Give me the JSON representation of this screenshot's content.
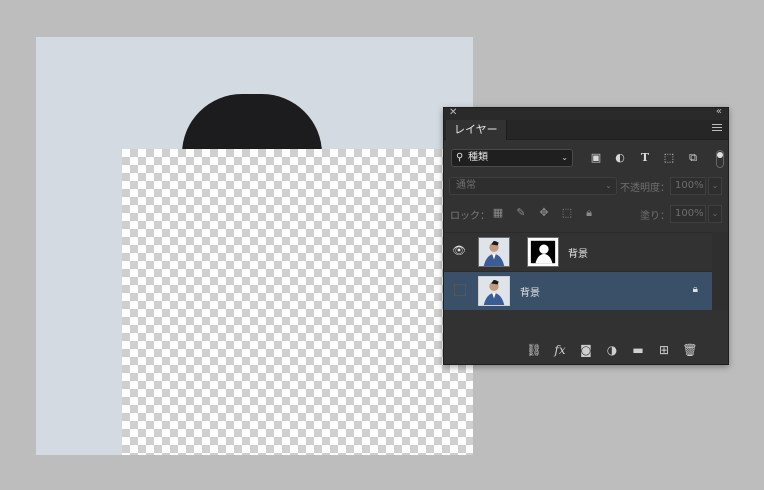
{
  "panel": {
    "tab_label": "レイヤー",
    "filter": {
      "selected": "種類"
    },
    "blend": {
      "mode": "通常",
      "opacity_label": "不透明度：",
      "opacity_value": "100%"
    },
    "lock": {
      "label": "ロック：",
      "fill_label": "塗り：",
      "fill_value": "100%"
    },
    "layers": [
      {
        "name": "背景",
        "visible": true,
        "has_mask": true,
        "selected": false,
        "locked": false
      },
      {
        "name": "背景",
        "visible": false,
        "has_mask": false,
        "selected": true,
        "locked": true
      }
    ],
    "icons": {
      "filter_icons": [
        "image-filter-icon",
        "adjustment-filter-icon",
        "type-filter-icon",
        "shape-filter-icon",
        "smart-object-filter-icon"
      ],
      "footer_icons": [
        "link-layers-icon",
        "fx-icon",
        "add-mask-icon",
        "new-adjustment-icon",
        "new-group-icon",
        "new-layer-icon",
        "delete-layer-icon"
      ]
    }
  },
  "colors": {
    "panel_bg": "#323232",
    "selected_layer": "#3a5068",
    "arrow": "#e8343a",
    "canvas_bg": "#d3dae2"
  }
}
